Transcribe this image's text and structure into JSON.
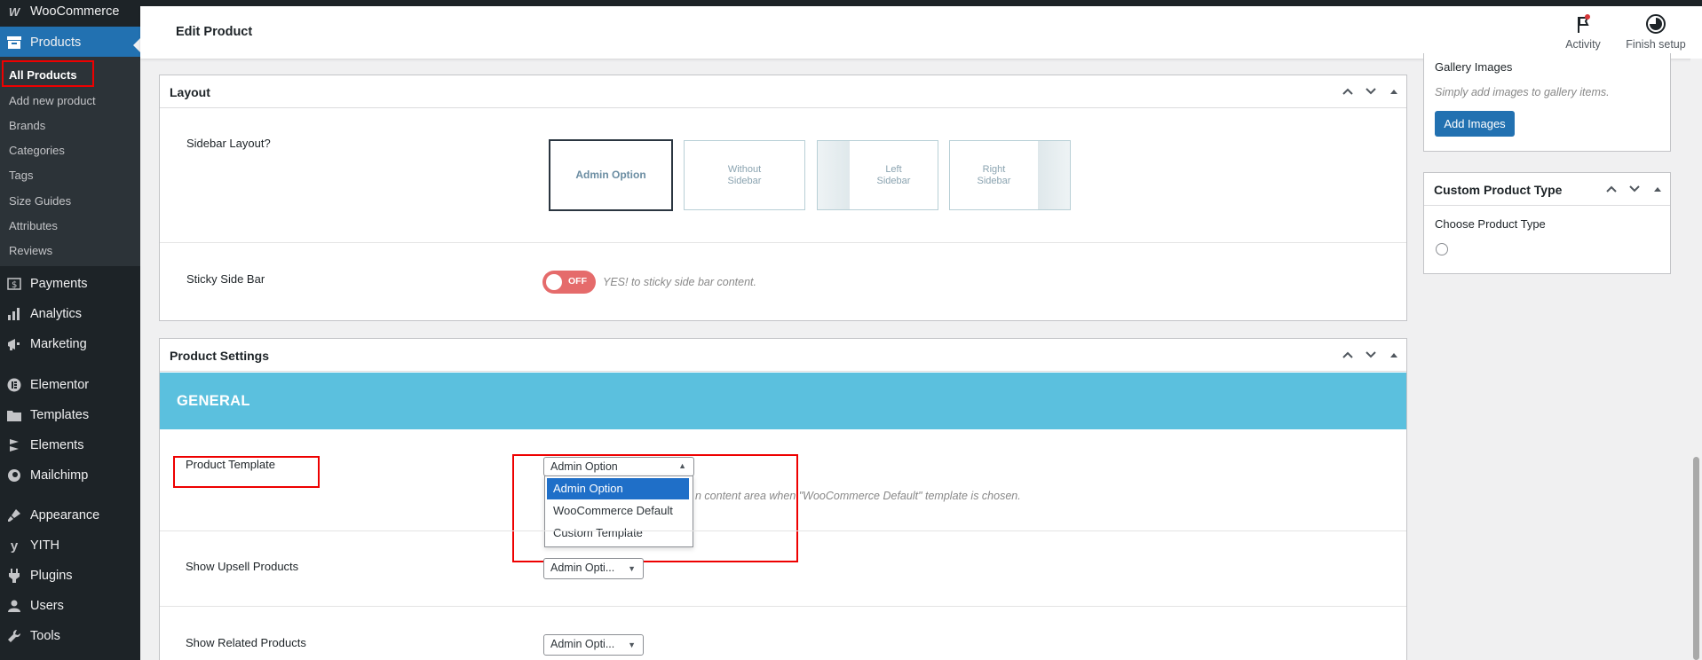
{
  "sidebar": {
    "brand": "WooCommerce",
    "products": "Products",
    "submenu": [
      "All Products",
      "Add new product",
      "Brands",
      "Categories",
      "Tags",
      "Size Guides",
      "Attributes",
      "Reviews"
    ],
    "menu": [
      "Payments",
      "Analytics",
      "Marketing",
      "Elementor",
      "Templates",
      "Elements",
      "Mailchimp",
      "Appearance",
      "YITH",
      "Plugins",
      "Users",
      "Tools"
    ]
  },
  "header": {
    "title": "Edit Product",
    "activity": "Activity",
    "finish_setup": "Finish setup"
  },
  "layout_panel": {
    "title": "Layout",
    "sidebar_layout_label": "Sidebar Layout?",
    "options": {
      "admin": "Admin Option",
      "without_1": "Without",
      "without_2": "Sidebar",
      "left_1": "Left",
      "left_2": "Sidebar",
      "right_1": "Right",
      "right_2": "Sidebar"
    },
    "sticky_label": "Sticky Side Bar",
    "toggle_text": "OFF",
    "sticky_hint": "YES! to sticky side bar content."
  },
  "product_settings": {
    "title": "Product Settings",
    "section": "GENERAL",
    "product_template_label": "Product Template",
    "product_template_value": "Admin Option",
    "product_template_hint": "n content area when \"WooCommerce Default\" template is chosen.",
    "dropdown_options": [
      "Admin Option",
      "WooCommerce Default",
      "Custom Template"
    ],
    "upsell_label": "Show Upsell Products",
    "upsell_value": "Admin Opti...",
    "related_label": "Show Related Products",
    "related_value": "Admin Opti..."
  },
  "gallery": {
    "title": "Gallery Images",
    "hint": "Simply add images to gallery items.",
    "button": "Add Images"
  },
  "custom_type": {
    "title": "Custom Product Type",
    "label": "Choose Product Type"
  },
  "colors": {
    "sidebar": "#1d2327",
    "accent": "#2271b1",
    "general_band": "#5bc0de",
    "toggle_off": "#e56b6b",
    "highlight_box": "#ee0000"
  }
}
